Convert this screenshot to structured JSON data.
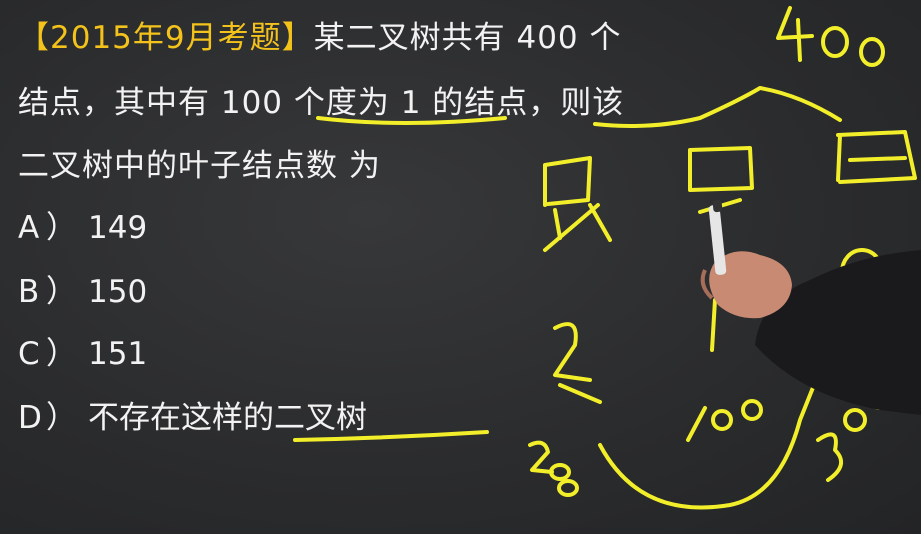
{
  "question": {
    "tag": "【2015年9月考题】",
    "line1_text": "某二叉树共有 400 个",
    "line2_text": "结点，其中有 100 个度为 1 的结点，则该",
    "line3_text": "二叉树中的叶子结点数 为"
  },
  "options": [
    {
      "letter": "A",
      "paren": "）",
      "text": "149"
    },
    {
      "letter": "B",
      "paren": "）",
      "text": "150"
    },
    {
      "letter": "C",
      "paren": "）",
      "text": "151"
    },
    {
      "letter": "D",
      "paren": "）",
      "text": "不存在这样的二叉树"
    }
  ],
  "colors": {
    "board": "#2b2b2d",
    "text": "#f2f2f2",
    "tag": "#f3c21b",
    "chalk": "#f2ef2a"
  },
  "handwriting": {
    "total": "400",
    "degree1": "100",
    "remainder": "300",
    "leaf_guess": "200"
  }
}
